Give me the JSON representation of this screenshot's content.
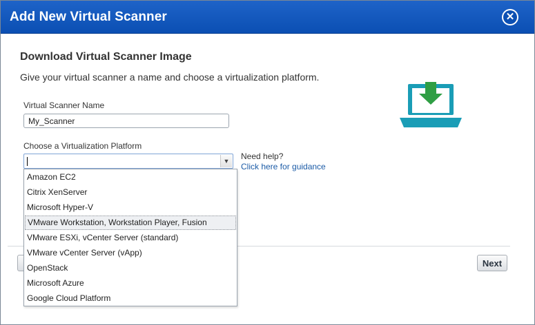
{
  "dialog": {
    "title": "Add New Virtual Scanner",
    "close_label": "✕"
  },
  "content": {
    "heading": "Download Virtual Scanner Image",
    "description": "Give your virtual scanner a name and choose a virtualization platform."
  },
  "form": {
    "name_label": "Virtual Scanner Name",
    "name_value": "My_Scanner",
    "platform_label": "Choose a Virtualization Platform",
    "platform_value": "",
    "arrow_glyph": "▼"
  },
  "help": {
    "text": "Need help?",
    "link": "Click here for guidance"
  },
  "platform_options": [
    "Amazon EC2",
    "Citrix XenServer",
    "Microsoft Hyper-V",
    "VMware Workstation, Workstation Player, Fusion",
    "VMware ESXi, vCenter Server (standard)",
    "VMware vCenter Server (vApp)",
    "OpenStack",
    "Microsoft Azure",
    "Google Cloud Platform"
  ],
  "hovered_option": "VMware Workstation, Workstation Player, Fusion",
  "footer": {
    "next_label": "Next"
  },
  "colors": {
    "titlebar": "#0b4fb3",
    "illustration_teal": "#1a9db6",
    "illustration_green": "#2f9e44",
    "link": "#1a5aa6"
  },
  "icons": {
    "close": "close-icon",
    "illustration": "download-laptop-icon",
    "dropdown_arrow": "chevron-down-icon"
  }
}
